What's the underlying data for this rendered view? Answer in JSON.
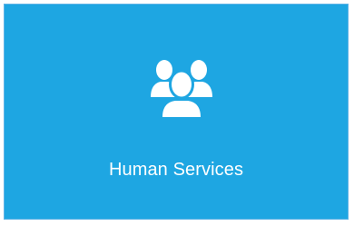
{
  "tile": {
    "label": "Human Services",
    "icon": "users-group-icon",
    "background_color": "#1ea6e2",
    "text_color": "#ffffff"
  }
}
